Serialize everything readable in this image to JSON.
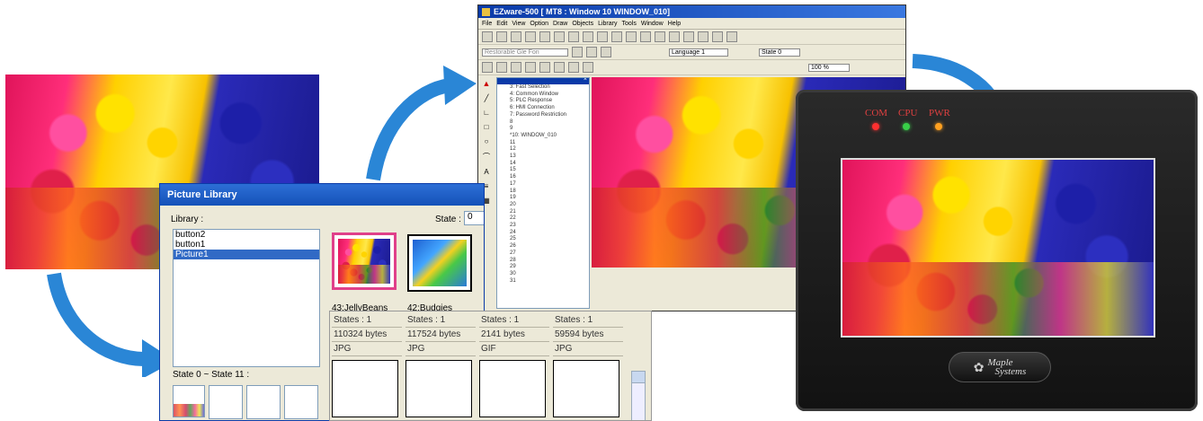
{
  "colors": {
    "arrow": "#2a86d6",
    "title_bar": "#1a56be",
    "selection": "#316ac5",
    "led_com": "#ff3030",
    "led_cpu": "#38d048",
    "led_pwr": "#ffa020",
    "hmi_body": "#1c1c1c"
  },
  "picture_library": {
    "title": "Picture Library",
    "library_label": "Library :",
    "state_label": "State :",
    "state_value": "0",
    "items": [
      "button2",
      "button1",
      "Picture1"
    ],
    "state_range_label": "State 0 ~ State 11 :",
    "pictures": [
      {
        "name": "43:JellyBeans",
        "states": "States : 1",
        "size": "110324 bytes",
        "format": "JPG"
      },
      {
        "name": "42:Budgies",
        "states": "States : 1",
        "size": "117524 bytes",
        "format": "JPG"
      },
      {
        "name": "",
        "states": "States : 1",
        "size": "2141 bytes",
        "format": "GIF"
      },
      {
        "name": "",
        "states": "States : 1",
        "size": "59594 bytes",
        "format": "JPG"
      }
    ]
  },
  "ezware": {
    "title": "EZware-500  [  MT8  :  Window 10   WINDOW_010]",
    "menu": [
      "File",
      "Edit",
      "View",
      "Option",
      "Draw",
      "Objects",
      "Library",
      "Tools",
      "Window",
      "Help"
    ],
    "font_box": "Restorable Gle Fon",
    "language": "Language 1",
    "state_label": "State  0",
    "zoom": "100 %",
    "tree": [
      "3: Fast Selection",
      "4: Common Window",
      "5: PLC Response",
      "6: HMI Connection",
      "7: Password Restriction",
      "8",
      "9",
      "*10: WINDOW_010",
      "11",
      "12",
      "13",
      "14",
      "15",
      "16",
      "17",
      "18",
      "19",
      "20",
      "21",
      "22",
      "23",
      "24",
      "25",
      "26",
      "27",
      "28",
      "29",
      "30",
      "31"
    ]
  },
  "hmi": {
    "led_labels": [
      "COM",
      "CPU",
      "PWR"
    ],
    "brand": "Maple Systems",
    "brand_line1": "Maple",
    "brand_line2": "Systems"
  }
}
